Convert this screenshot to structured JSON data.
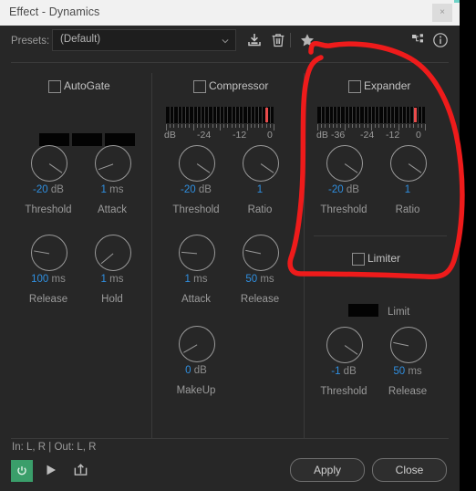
{
  "window": {
    "title": "Effect - Dynamics",
    "close_label": "×"
  },
  "presetbar": {
    "label": "Presets:",
    "value": "(Default)",
    "placeholder": "(Default)",
    "icons": [
      {
        "name": "save-preset-icon",
        "title": "Save Settings As"
      },
      {
        "name": "delete-preset-icon",
        "title": "Delete Setting"
      },
      {
        "name": "favorite-star-icon",
        "title": "Add to Favorites"
      },
      {
        "name": "routing-icon",
        "title": "Channel Mapping"
      },
      {
        "name": "info-icon",
        "title": "Info"
      }
    ]
  },
  "sections": {
    "autogate": {
      "title": "AutoGate",
      "checked": false,
      "leds": 3,
      "knobs": [
        {
          "value": "-20",
          "unit": "dB",
          "caption": "Threshold",
          "angle": 35
        },
        {
          "value": "1",
          "unit": "ms",
          "caption": "Attack",
          "angle": 160
        },
        {
          "value": "100",
          "unit": "ms",
          "caption": "Release",
          "angle": 190
        },
        {
          "value": "1",
          "unit": "ms",
          "caption": "Hold",
          "angle": 140
        }
      ]
    },
    "compressor": {
      "title": "Compressor",
      "checked": false,
      "meter": {
        "labels": [
          "dB",
          "-24",
          "-12",
          "0"
        ],
        "red_position_pct": 92
      },
      "knobs": [
        {
          "value": "-20",
          "unit": "dB",
          "caption": "Threshold",
          "angle": 35
        },
        {
          "value": "1",
          "unit": "",
          "caption": "Ratio",
          "angle": 35
        },
        {
          "value": "1",
          "unit": "ms",
          "caption": "Attack",
          "angle": 185
        },
        {
          "value": "50",
          "unit": "ms",
          "caption": "Release",
          "angle": 192
        },
        {
          "value": "0",
          "unit": "dB",
          "caption": "MakeUp",
          "angle": 150
        }
      ]
    },
    "expander": {
      "title": "Expander",
      "checked": false,
      "meter": {
        "labels": [
          "dB",
          "-36",
          "-24",
          "-12",
          "0"
        ],
        "red_position_pct": 90
      },
      "knobs": [
        {
          "value": "-20",
          "unit": "dB",
          "caption": "Threshold",
          "angle": 35
        },
        {
          "value": "1",
          "unit": "",
          "caption": "Ratio",
          "angle": 35
        }
      ]
    },
    "limiter": {
      "title": "Limiter",
      "checked": false,
      "limit_label": "Limit",
      "knobs": [
        {
          "value": "-1",
          "unit": "dB",
          "caption": "Threshold",
          "angle": 35
        },
        {
          "value": "50",
          "unit": "ms",
          "caption": "Release",
          "angle": 192
        }
      ]
    }
  },
  "footer": {
    "io_text": "In: L, R | Out: L, R",
    "power_icon": "power-icon",
    "preview_icon": "play-icon",
    "export_icon": "export-icon",
    "apply_label": "Apply",
    "close_label": "Close"
  },
  "annotation": {
    "name": "red-hand-drawn-ellipse",
    "color": "#ee1b1b",
    "targets": "Expander section"
  },
  "colors": {
    "accent_value": "#2f8fe0",
    "panel_bg": "#272727",
    "titlebar_bg": "#f1f1f1",
    "power_green": "#3a9e6a",
    "meter_red": "#e84b4b",
    "annotation_red": "#ee1b1b"
  }
}
